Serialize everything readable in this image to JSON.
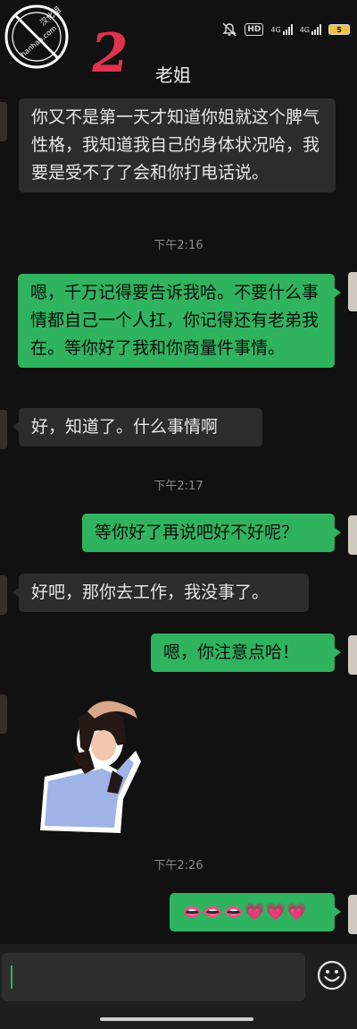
{
  "status": {
    "hd": "HD",
    "net1": "4G",
    "net2": "4G",
    "battery": "5"
  },
  "header": {
    "title": "老姐",
    "watermark_top": "汉化组",
    "watermark_bottom": "hanhao.com",
    "big_number": "2"
  },
  "messages": [
    {
      "side": "in",
      "text": "你又不是第一天才知道你姐就这个脾气性格，我知道我自己的身体状况哈，我要是受不了了会和你打电话说。"
    },
    {
      "side": "time",
      "text": "下午2:16"
    },
    {
      "side": "out",
      "text": "嗯，千万记得要告诉我哈。不要什么事情都自己一个人扛，你记得还有老弟我在。等你好了我和你商量件事情。"
    },
    {
      "side": "in",
      "text": "好，知道了。什么事情啊"
    },
    {
      "side": "time",
      "text": "下午2:17"
    },
    {
      "side": "out",
      "text": "等你好了再说吧好不好呢？"
    },
    {
      "side": "in",
      "text": "好吧，那你去工作，我没事了。"
    },
    {
      "side": "out",
      "text": "嗯，你注意点哈！"
    },
    {
      "side": "sticker",
      "text": ""
    },
    {
      "side": "time",
      "text": "下午2:26"
    },
    {
      "side": "out",
      "text": "👄👄👄💗💗💗"
    }
  ],
  "icons": {
    "mute": "bell-off-icon",
    "emoji": "emoji-smile-icon"
  },
  "colors": {
    "outgoing_bubble": "#2fb35f",
    "incoming_bubble": "#2c2c2c",
    "background": "#111111"
  }
}
